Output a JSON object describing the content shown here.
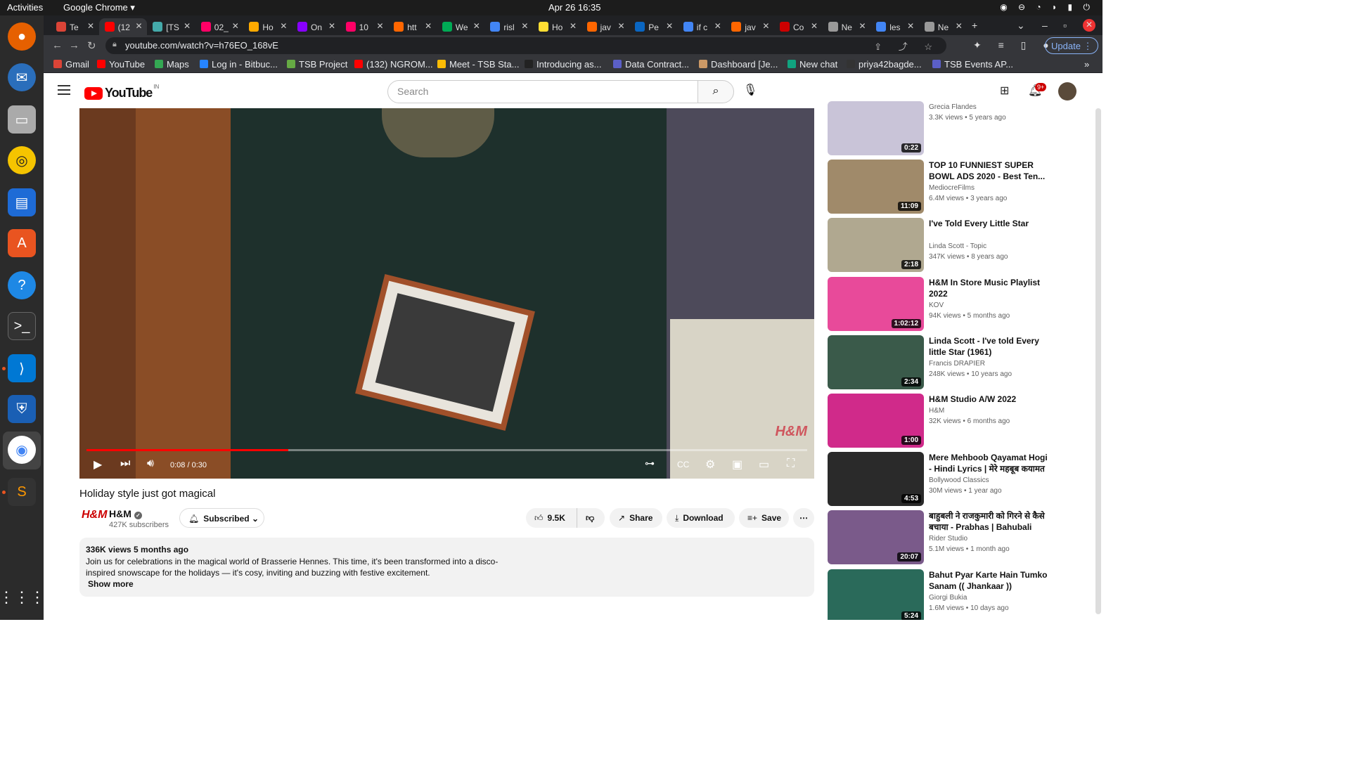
{
  "os": {
    "activities": "Activities",
    "app_name": "Google Chrome",
    "clock": "Apr 26  16:35"
  },
  "tabs": [
    {
      "label": "Te",
      "color": "#db4437"
    },
    {
      "label": "(12",
      "color": "#ff0000",
      "active": true
    },
    {
      "label": "[TS",
      "color": "#4aa"
    },
    {
      "label": "02_",
      "color": "#f06"
    },
    {
      "label": "Ho",
      "color": "#fa0"
    },
    {
      "label": "On",
      "color": "#80f"
    },
    {
      "label": "10",
      "color": "#f06"
    },
    {
      "label": "htt",
      "color": "#f60"
    },
    {
      "label": "We",
      "color": "#0a5"
    },
    {
      "label": "risl",
      "color": "#4285f4"
    },
    {
      "label": "Ho",
      "color": "#fd3"
    },
    {
      "label": "jav",
      "color": "#f60"
    },
    {
      "label": "Pe",
      "color": "#0a66c2"
    },
    {
      "label": "if c",
      "color": "#4285f4"
    },
    {
      "label": "jav",
      "color": "#f60"
    },
    {
      "label": "Co",
      "color": "#c00"
    },
    {
      "label": "Ne",
      "color": "#999"
    },
    {
      "label": "les",
      "color": "#4285f4"
    },
    {
      "label": "Ne",
      "color": "#999"
    }
  ],
  "address_bar": {
    "url": "youtube.com/watch?v=h76EO_168vE",
    "update_label": "Update"
  },
  "bookmarks": [
    {
      "label": "Gmail",
      "color": "#db4437"
    },
    {
      "label": "YouTube",
      "color": "#f00"
    },
    {
      "label": "Maps",
      "color": "#34a853"
    },
    {
      "label": "Log in - Bitbuc...",
      "color": "#2684ff"
    },
    {
      "label": "TSB Project",
      "color": "#6a4"
    },
    {
      "label": "(132) NGROM...",
      "color": "#f00"
    },
    {
      "label": "Meet - TSB Sta...",
      "color": "#fbbc05"
    },
    {
      "label": "Introducing as...",
      "color": "#222"
    },
    {
      "label": "Data Contract...",
      "color": "#5b5fc7"
    },
    {
      "label": "Dashboard [Je...",
      "color": "#c96"
    },
    {
      "label": "New chat",
      "color": "#10a37f"
    },
    {
      "label": "priya42bagde...",
      "color": "#333"
    },
    {
      "label": "TSB Events AP...",
      "color": "#5b5fc7"
    }
  ],
  "youtube": {
    "logo_text": "YouTube",
    "country_code": "IN",
    "search_placeholder": "Search",
    "notifications_badge": "9+"
  },
  "player": {
    "current_time": "0:08 / 0:30",
    "progress_fraction": 0.28,
    "watermark": "H&M"
  },
  "video": {
    "title": "Holiday style just got magical",
    "channel_logo": "H&M",
    "channel": "H&M",
    "subscribers": "427K subscribers",
    "subscribed_label": "Subscribed",
    "likes": "9.5K",
    "share_label": "Share",
    "download_label": "Download",
    "save_label": "Save",
    "views_age": "336K views  5 months ago",
    "description": "Join us for celebrations in the magical world of Brasserie Hennes. This time, it's been transformed into a disco-inspired snowscape for the holidays — it's cosy, inviting and buzzing with festive excitement.",
    "show_more": "Show more"
  },
  "recommendations": [
    {
      "title": "",
      "channel": "Grecia Flandes",
      "meta": "3.3K views  •  5 years ago",
      "duration": "0:22",
      "thumb": "#c9c4d8"
    },
    {
      "title": "TOP 10 FUNNIEST SUPER BOWL ADS 2020 - Best Ten...",
      "channel": "MediocreFilms",
      "meta": "6.4M views  •  3 years ago",
      "duration": "11:09",
      "thumb": "#a08a6a"
    },
    {
      "title": "I've Told Every Little Star",
      "channel": "Linda Scott - Topic",
      "meta": "347K views  •  8 years ago",
      "duration": "2:18",
      "thumb": "#b0a890"
    },
    {
      "title": "H&M In Store Music Playlist 2022",
      "channel": "KOV",
      "meta": "94K views  •  5 months ago",
      "duration": "1:02:12",
      "thumb": "#e84a9a"
    },
    {
      "title": "Linda Scott - I've told Every little Star (1961)",
      "channel": "Francis DRAPIER",
      "meta": "248K views  •  10 years ago",
      "duration": "2:34",
      "thumb": "#3a5a4a"
    },
    {
      "title": "H&M Studio A/W 2022",
      "channel": "H&M",
      "meta": "32K views  •  6 months ago",
      "duration": "1:00",
      "thumb": "#d02a8a"
    },
    {
      "title": "Mere Mehboob Qayamat Hogi - Hindi Lyrics | मेरे महबूब कयामत हो...",
      "channel": "Bollywood Classics",
      "meta": "30M views  •  1 year ago",
      "duration": "4:53",
      "thumb": "#2a2a2a"
    },
    {
      "title": "बाहुबली ने राजकुमारी को गिरने से कैसे बचाया - Prabhas | Bahubali Full...",
      "channel": "Rider Studio",
      "meta": "5.1M views  •  1 month ago",
      "duration": "20:07",
      "thumb": "#7a5a8a"
    },
    {
      "title": "Bahut Pyar Karte Hain Tumko Sanam (( Jhankaar )) Madhuri...",
      "channel": "Giorgi Bukia",
      "meta": "1.6M views  •  10 days ago",
      "duration": "5:24",
      "thumb": "#2a6a5a"
    }
  ]
}
